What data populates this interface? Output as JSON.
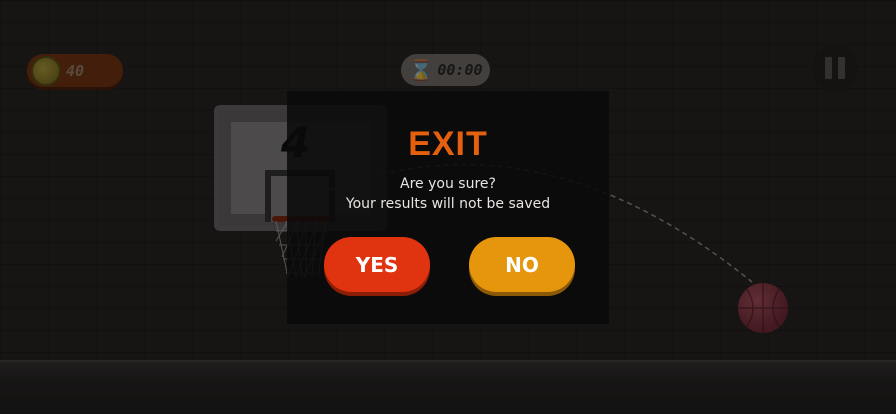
{
  "hud": {
    "coins": "40",
    "coin_icon": "coin-icon",
    "timer_icon": "hourglass-icon",
    "timer": "00:00",
    "pause_icon": "pause-icon"
  },
  "court": {
    "shot_count": "4"
  },
  "exit_dialog": {
    "title": "EXIT",
    "question": "Are you sure?",
    "warning": "Your results will not be saved",
    "yes_label": "YES",
    "no_label": "NO"
  },
  "colors": {
    "title_orange": "#e5600e",
    "yes_red": "#e0330f",
    "no_orange": "#e5960c",
    "overlay": "#0a0a0a"
  }
}
